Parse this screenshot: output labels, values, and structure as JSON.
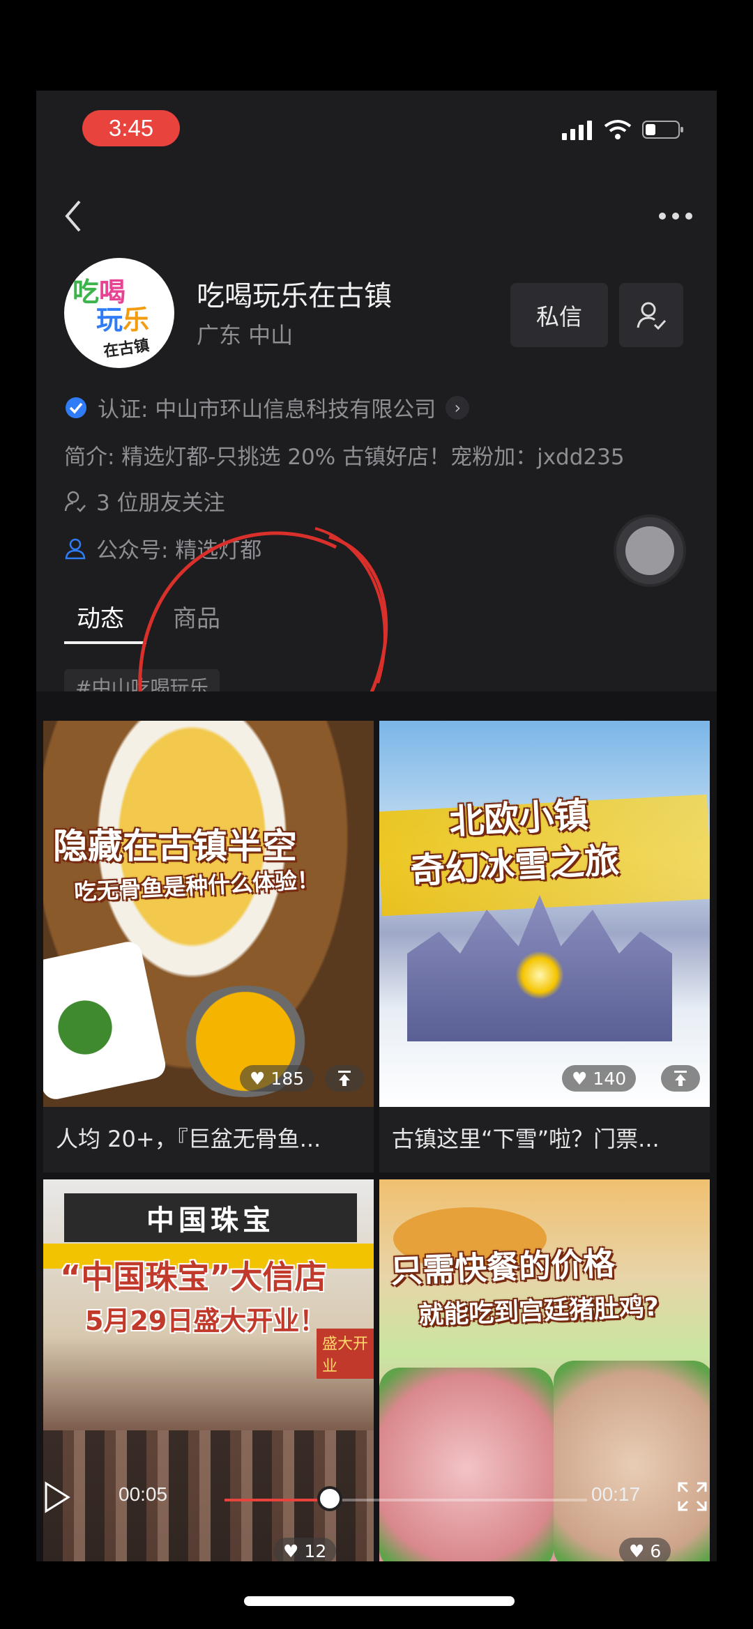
{
  "status_bar": {
    "time": "3:45"
  },
  "profile": {
    "name": "吃喝玩乐在古镇",
    "location": "广东 中山",
    "avatar_text": [
      "吃喝",
      "玩乐",
      "在古镇"
    ],
    "message_label": "私信"
  },
  "info": {
    "verification": "认证: 中山市环山信息科技有限公司",
    "bio": "简介: 精选灯都-只挑选 20% 古镇好店！宠粉加：jxdd235",
    "friends": "3 位朋友关注",
    "official_account": "公众号: 精选灯都"
  },
  "tabs": [
    {
      "label": "动态",
      "active": true
    },
    {
      "label": "商品",
      "active": false
    }
  ],
  "hashtag": "#中山吃喝玩乐",
  "posts": [
    {
      "title": "人均 20+，『巨盆无骨鱼...",
      "overlay_line1": "隐藏在古镇半空",
      "overlay_line2": "吃无骨鱼是种什么体验！",
      "likes": "185"
    },
    {
      "title": "古镇这里“下雪”啦？门票...",
      "overlay_line1": "北欧小镇",
      "overlay_line2": "奇幻冰雪之旅",
      "likes": "140"
    },
    {
      "title": "",
      "sign": "中国珠宝",
      "overlay_line1": "“中国珠宝”大信店",
      "overlay_line2": "5月29日盛大开业！",
      "banner": "盛大开业",
      "likes": "12"
    },
    {
      "title": "",
      "overlay_line1": "只需快餐的价格",
      "overlay_line2": "就能吃到宫廷猪肚鸡?",
      "likes": "6"
    }
  ],
  "video": {
    "current": "00:05",
    "total": "00:17",
    "progress": 0.29
  },
  "colors": {
    "accent": "#e8433c",
    "background": "#1d1d20",
    "verified": "#2f7cf6"
  }
}
